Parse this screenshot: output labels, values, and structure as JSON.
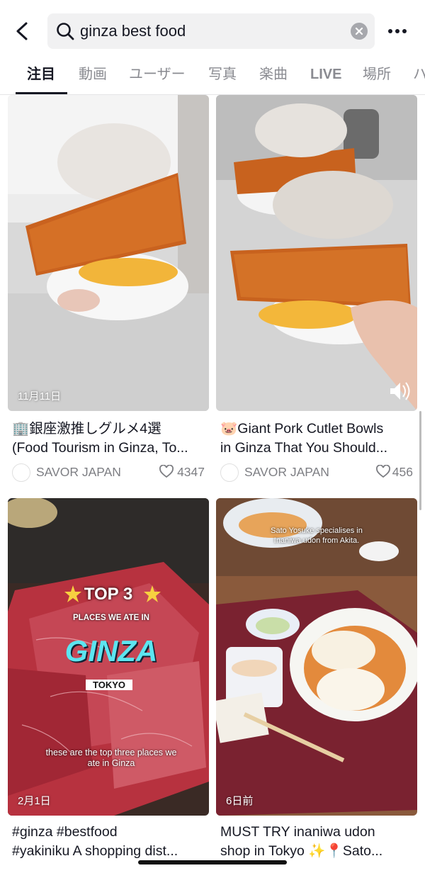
{
  "search": {
    "query": "ginza best food"
  },
  "tabs": [
    {
      "label": "注目"
    },
    {
      "label": "動画"
    },
    {
      "label": "ユーザー"
    },
    {
      "label": "写真"
    },
    {
      "label": "楽曲"
    },
    {
      "label": "LIVE"
    },
    {
      "label": "場所"
    },
    {
      "label": "ハ"
    }
  ],
  "cards": [
    {
      "date": "11月11日",
      "title_line1": "🏢銀座激推しグルメ4選",
      "title_line2": "(Food Tourism in Ginza, To...",
      "author": "SAVOR JAPAN",
      "likes": "4347"
    },
    {
      "date": "",
      "title_line1": "🐷Giant Pork Cutlet Bowls",
      "title_line2": "in Ginza That You Should...",
      "author": "SAVOR JAPAN",
      "likes": "456"
    },
    {
      "date": "2月1日",
      "title_line1": "#ginza #bestfood",
      "title_line2": "#yakiniku A shopping dist...",
      "overlay": {
        "top": "TOP 3",
        "places": "PLACES WE ATE IN",
        "city": "GINZA",
        "sub": "TOKYO",
        "caption1": "these are the top three places we",
        "caption2": "ate in Ginza"
      }
    },
    {
      "date": "6日前",
      "title_line1": "MUST TRY inaniwa udon",
      "title_line2": "shop in Tokyo ✨📍Sato...",
      "overlay": {
        "caption1": "Sato Yosuke specialises in",
        "caption2": "Inaniwa udon from Akita."
      }
    }
  ],
  "colors": {
    "text": "#161823",
    "muted": "#7d7e83",
    "search_bg": "#f1f1f2"
  }
}
